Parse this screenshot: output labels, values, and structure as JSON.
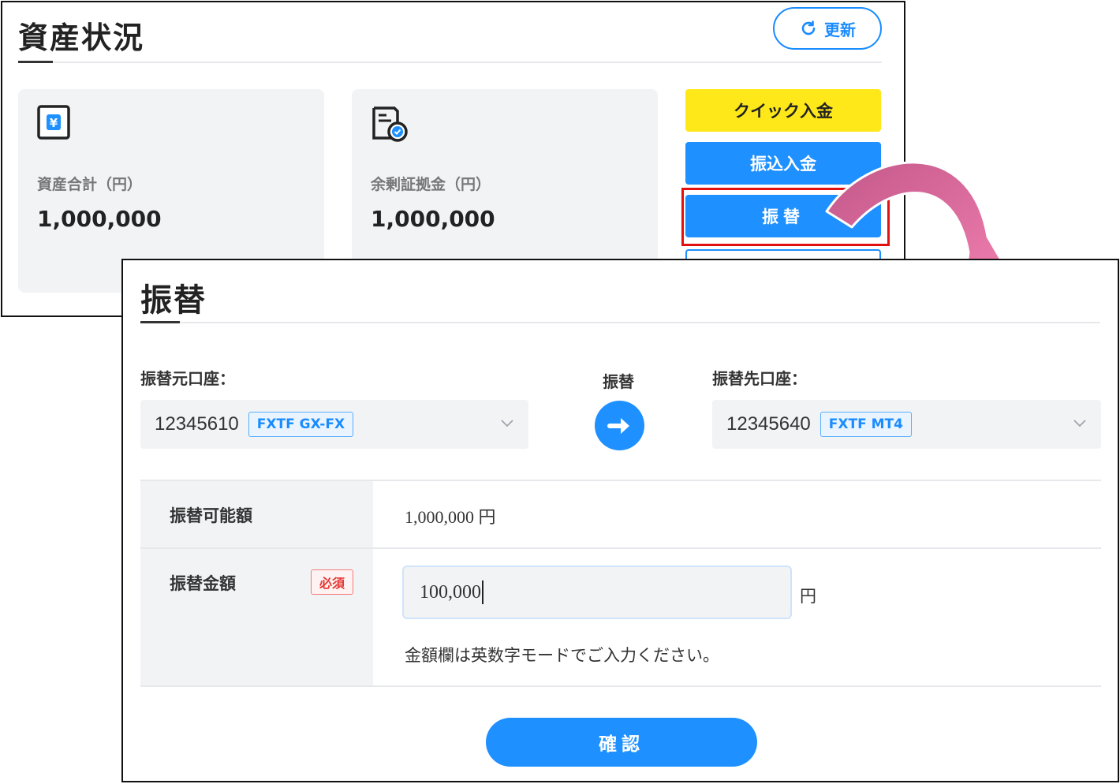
{
  "asset_panel": {
    "title": "資産状況",
    "refresh_label": "更新",
    "cards": [
      {
        "icon": "yen-icon",
        "label": "資産合計（円）",
        "value": "1,000,000"
      },
      {
        "icon": "document-check-icon",
        "label": "余剰証拠金（円）",
        "value": "1,000,000"
      }
    ],
    "buttons": {
      "quick_deposit": "クイック入金",
      "bank_deposit": "振込入金",
      "transfer": "振替"
    }
  },
  "transfer_modal": {
    "title": "振替",
    "from": {
      "label": "振替元口座：",
      "account": "12345610",
      "tag": "FXTF GX-FX"
    },
    "middle_label": "振替",
    "to": {
      "label": "振替先口座：",
      "account": "12345640",
      "tag": "FXTF MT4"
    },
    "available": {
      "label": "振替可能額",
      "value": "1,000,000 円"
    },
    "amount": {
      "label": "振替金額",
      "required": "必須",
      "value": "100,000",
      "unit": "円"
    },
    "hint": "金額欄は英数字モードでご入力ください。",
    "confirm_label": "確認"
  },
  "colors": {
    "primary": "#1e90ff",
    "quick_deposit": "#ffe81a",
    "highlight": "#e31010",
    "arrow": "#e87aa8"
  }
}
